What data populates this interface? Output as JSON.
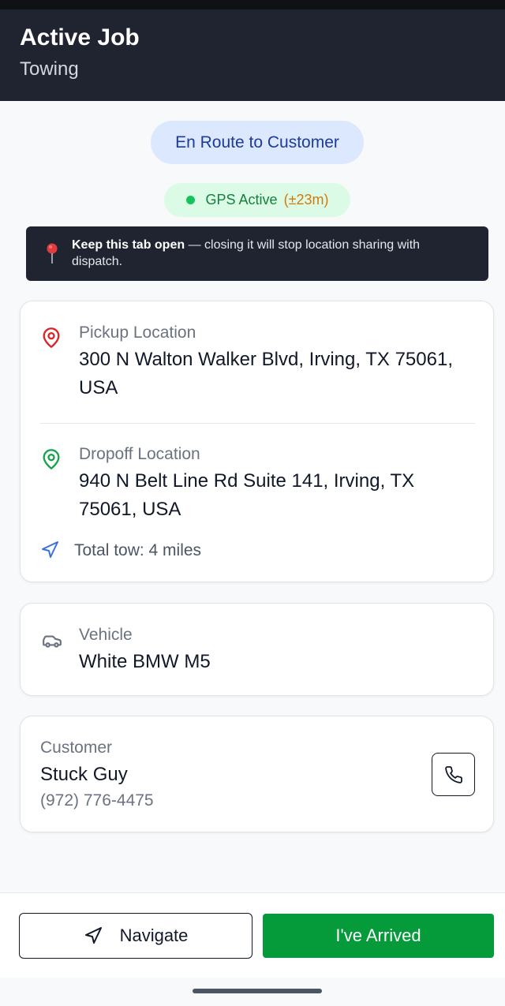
{
  "header": {
    "title": "Active Job",
    "subtitle": "Towing"
  },
  "status": {
    "label": "En Route to Customer"
  },
  "gps": {
    "label": "GPS Active",
    "accuracy": "(±23m)"
  },
  "warning": {
    "bold": "Keep this tab open",
    "text": " — closing it will stop location sharing with dispatch."
  },
  "locations": {
    "pickup_label": "Pickup Location",
    "pickup_address": "300 N Walton Walker Blvd, Irving, TX 75061, USA",
    "dropoff_label": "Dropoff Location",
    "dropoff_address": "940 N Belt Line Rd Suite 141, Irving, TX 75061, USA",
    "total_tow": "Total tow: 4 miles"
  },
  "vehicle": {
    "label": "Vehicle",
    "value": "White BMW M5"
  },
  "customer": {
    "label": "Customer",
    "name": "Stuck Guy",
    "phone": "(972) 776-4475"
  },
  "actions": {
    "navigate_label": "Navigate",
    "arrived_label": "I've Arrived"
  },
  "colors": {
    "header_bg": "#1f2430",
    "accent_green": "#059b3a",
    "status_blue": "#1e3a9a",
    "pickup_red": "#dc2626",
    "dropoff_green": "#16a34a"
  }
}
